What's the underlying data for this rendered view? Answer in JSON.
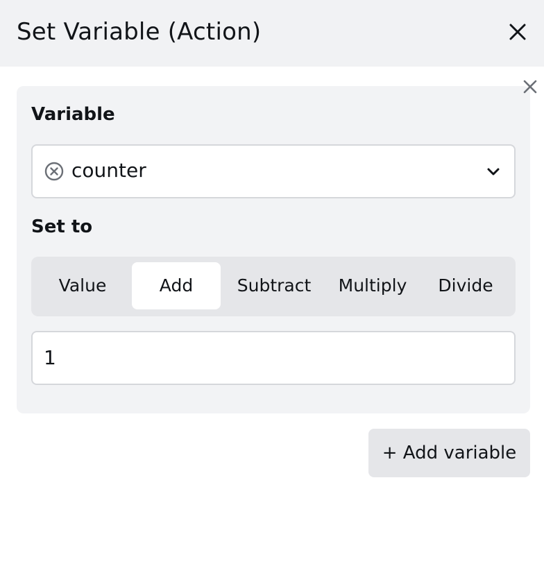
{
  "header": {
    "title": "Set Variable (Action)",
    "close_icon": "close-icon"
  },
  "card": {
    "remove_icon": "close-icon",
    "variable_label": "Variable",
    "variable_select": {
      "value": "counter",
      "clear_icon": "clear-circle-icon",
      "dropdown_icon": "chevron-down-icon"
    },
    "set_to_label": "Set to",
    "operations": [
      {
        "label": "Value",
        "selected": false
      },
      {
        "label": "Add",
        "selected": true
      },
      {
        "label": "Subtract",
        "selected": false
      },
      {
        "label": "Multiply",
        "selected": false
      },
      {
        "label": "Divide",
        "selected": false
      }
    ],
    "amount_value": "1"
  },
  "footer": {
    "add_variable_label": "+ Add variable"
  },
  "colors": {
    "header_bg": "#f1f2f4",
    "card_bg": "#f2f3f5",
    "segment_bg": "#e5e6e9",
    "text": "#111418",
    "icon_muted": "#6b6f76"
  }
}
